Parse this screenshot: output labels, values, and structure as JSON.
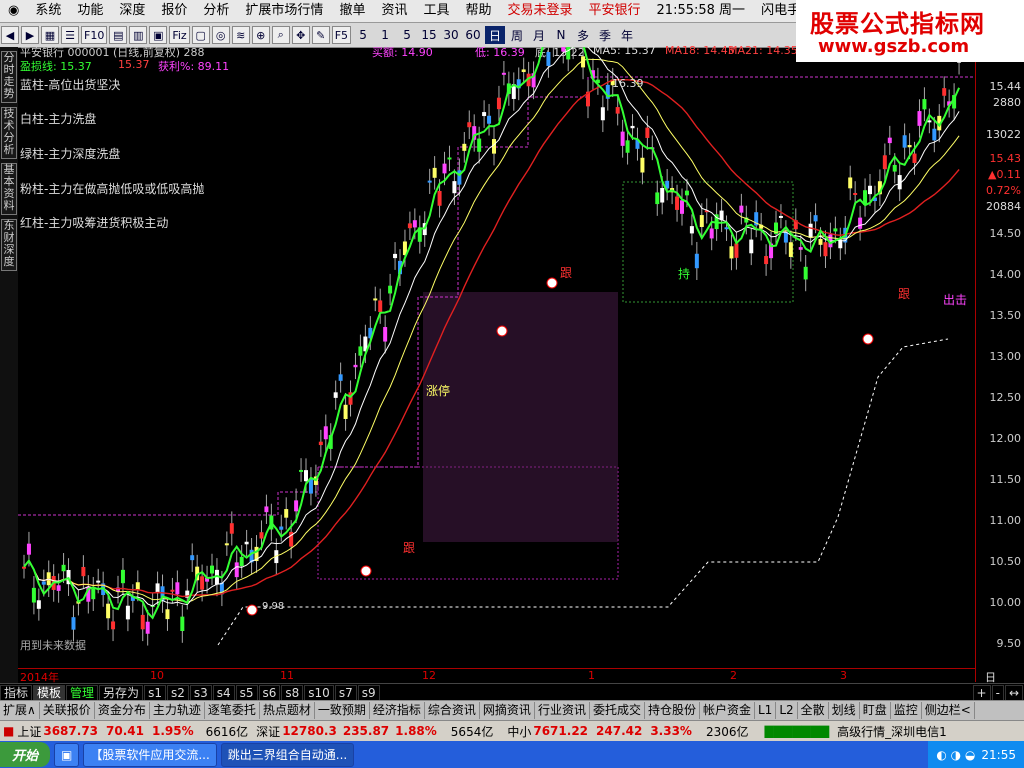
{
  "menu": {
    "items": [
      "系统",
      "功能",
      "深度",
      "报价",
      "分析",
      "扩展市场行情",
      "撤单",
      "资讯",
      "工具",
      "帮助"
    ],
    "trade_status": "交易未登录",
    "stock_name_top": "平安银行",
    "clock": "21:55:58 周一",
    "flash": "闪电手"
  },
  "brand": {
    "title": "股票公式指标网",
    "url": "www.gszb.com"
  },
  "toolbar": {
    "periods": [
      "5",
      "1",
      "5",
      "15",
      "30",
      "60",
      "日",
      "周",
      "月",
      "N",
      "多",
      "季",
      "年"
    ]
  },
  "sidetabs": [
    "分时走势",
    "技术分析",
    "基本资料",
    "东财深度"
  ],
  "header": {
    "line1": "平安银行 000001 (日线,前复权) 288",
    "buy": "买额: 14.90",
    "low_prefix": "低: 16.39",
    "low": "底: 13.22",
    "ma5": "MA5: 15.37",
    "ma18": "MA18: 14.43",
    "ma21": "MA21: 14.35",
    "stop_line": "盈损线: 15.37",
    "stop_val": "15.37",
    "profit": "获利%: 89.11"
  },
  "legend": [
    {
      "text": "蓝柱-高位出货坚决",
      "color": "#ff4040"
    },
    {
      "text": "白柱-主力洗盘",
      "color": "#ffffff"
    },
    {
      "text": "绿柱-主力深度洗盘",
      "color": "#33ff33"
    },
    {
      "text": "粉柱-主力在做高抛低吸或低吸高抛",
      "color": "#ff44ff"
    },
    {
      "text": "红柱-主力吸筹进货积极主动",
      "color": "#ff3030"
    }
  ],
  "annotations": {
    "peak": "16.39",
    "limit_up": "涨停",
    "follow1": "跟",
    "follow2": "跟",
    "follow3": "跟",
    "hold": "持",
    "exit": "出击",
    "future": "用到未来数据",
    "low_mark": "9.98"
  },
  "price_axis": [
    "15.44",
    "2880",
    "13022",
    "15.43",
    "▲0.11",
    "0.72%",
    "20884",
    "14.50",
    "14.00",
    "13.50",
    "13.00",
    "12.50",
    "12.00",
    "11.50",
    "11.00",
    "10.50",
    "10.00",
    "9.50"
  ],
  "x_axis": [
    "2014年",
    "10",
    "11",
    "12",
    "1",
    "2",
    "3"
  ],
  "x_axis_right": "日线",
  "tabs1": [
    "指标",
    "模板",
    "管理",
    "另存为",
    "s1",
    "s2",
    "s3",
    "s4",
    "s5",
    "s6",
    "s8",
    "s10",
    "s7",
    "s9"
  ],
  "tabs2": [
    "扩展∧",
    "关联报价",
    "资金分布",
    "主力轨迹",
    "逐笔委托",
    "热点题材",
    "一致预期",
    "经济指标",
    "综合资讯",
    "网摘资讯",
    "行业资讯",
    "委托成交",
    "持仓股份",
    "帐户资金",
    "L1",
    "L2",
    "全散",
    "划线",
    "盯盘",
    "监控",
    "侧边栏<"
  ],
  "status": {
    "sh_label": "上证",
    "sh_val": "3687.73",
    "sh_chg": "70.41",
    "sh_pct": "1.95%",
    "sh_amt": "6616亿",
    "sz_label": "深证",
    "sz_val": "12780.3",
    "sz_chg": "235.87",
    "sz_pct": "1.88%",
    "sz_amt": "5654亿",
    "zx_label": "中小",
    "zx_val": "7671.22",
    "zx_chg": "247.42",
    "zx_pct": "3.33%",
    "zx_amt": "2306亿",
    "server": "高级行情_深圳电信1"
  },
  "taskbar": {
    "start": "开始",
    "tasks": [
      "【股票软件应用交流...",
      "跳出三界组合自动通..."
    ],
    "time": "21:55"
  },
  "chart_data": {
    "type": "line",
    "ylim": [
      9.5,
      15.6
    ],
    "notes": "candlestick K-line of 平安银行 with moving averages; prices read from axis",
    "x": [
      "2014-09",
      "2014-10",
      "2014-11",
      "2014-12",
      "2015-01",
      "2015-02",
      "2015-03"
    ],
    "series": [
      {
        "name": "close",
        "values": [
          10.4,
          10.1,
          11.0,
          14.2,
          16.0,
          14.0,
          13.8,
          15.4
        ]
      }
    ]
  }
}
